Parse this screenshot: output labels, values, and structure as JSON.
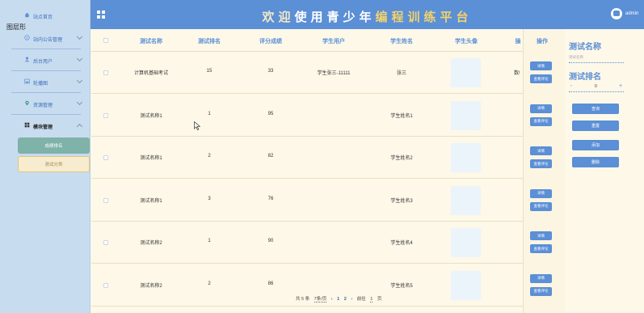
{
  "sidebar": {
    "home": "站点首页",
    "overlay": "图层形",
    "items": [
      {
        "label": "站内公告管理",
        "icon": "info-icon"
      },
      {
        "label": "后台用户",
        "icon": "user-icon"
      },
      {
        "label": "轮播图",
        "icon": "image-icon"
      },
      {
        "label": "资源管理",
        "icon": "pin-icon"
      },
      {
        "label": "模块管理",
        "icon": "grid-icon"
      }
    ],
    "sub_items": [
      "成绩排名",
      "测试分类"
    ]
  },
  "header": {
    "banner_a": "欢迎",
    "banner_b": "使用青少年",
    "banner_c": "编程训练平台",
    "user": "admin"
  },
  "table": {
    "columns": [
      "测试名称",
      "测试排名",
      "评分成绩",
      "学生用户",
      "学生姓名",
      "学生头像",
      "操"
    ],
    "rows": [
      {
        "name": "计算机基础考试",
        "rank": "15",
        "score": "33",
        "user": "学生张三-11111",
        "student": "张三",
        "extra": "数!"
      },
      {
        "name": "测试名称1",
        "rank": "1",
        "score": "95",
        "user": "",
        "student": "学生姓名1",
        "extra": ""
      },
      {
        "name": "测试名称1",
        "rank": "2",
        "score": "82",
        "user": "",
        "student": "学生姓名2",
        "extra": ""
      },
      {
        "name": "测试名称1",
        "rank": "3",
        "score": "76",
        "user": "",
        "student": "学生姓名3",
        "extra": ""
      },
      {
        "name": "测试名称2",
        "rank": "1",
        "score": "90",
        "user": "",
        "student": "学生姓名4",
        "extra": ""
      },
      {
        "name": "测试名称2",
        "rank": "2",
        "score": "86",
        "user": "",
        "student": "学生姓名5",
        "extra": ""
      }
    ]
  },
  "pagination": {
    "total": "共 5 条",
    "per_page": "7条/页",
    "pages": [
      "1",
      "2"
    ],
    "goto_label": "前往",
    "goto_value": "1",
    "page_unit": "页"
  },
  "ops": {
    "header": "操作",
    "detail": "详情",
    "review": "查看评论"
  },
  "search": {
    "name_label": "测试名称",
    "name_placeholder": "测试名称",
    "rank_label": "测试排名",
    "rank_value": "0",
    "minus": "-",
    "plus": "+",
    "query": "查询",
    "reset": "重置",
    "add": "添加",
    "delete": "删除"
  },
  "colors": {
    "accent": "#5b8fd6",
    "sidebar_bg": "#c8dcf0",
    "page_bg": "#fdf8e8",
    "active_sub": "#7fb2a8"
  }
}
